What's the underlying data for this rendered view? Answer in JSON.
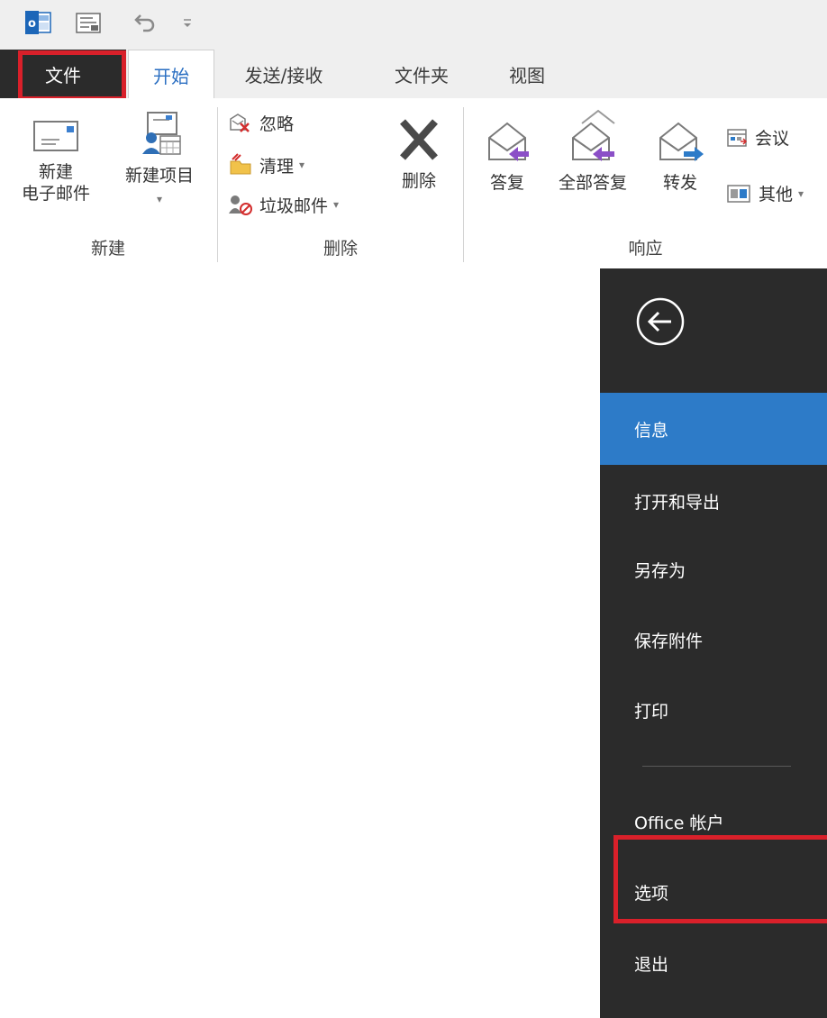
{
  "quick_access": {
    "icons": [
      "outlook-app-icon",
      "send-receive-all-icon",
      "undo-icon",
      "customize-qat-icon"
    ]
  },
  "tabs": [
    {
      "label": "文件"
    },
    {
      "label": "开始"
    },
    {
      "label": "发送/接收"
    },
    {
      "label": "文件夹"
    },
    {
      "label": "视图"
    }
  ],
  "ribbon": {
    "new_group": {
      "new_email_line1": "新建",
      "new_email_line2": "电子邮件",
      "new_items": "新建项目",
      "label": "新建"
    },
    "delete_group": {
      "ignore": "忽略",
      "clean_up": "清理",
      "junk": "垃圾邮件",
      "delete": "删除",
      "label": "删除"
    },
    "respond_group": {
      "reply": "答复",
      "reply_all": "全部答复",
      "forward": "转发",
      "meeting": "会议",
      "more": "其他",
      "label": "响应"
    },
    "caret": "▾"
  },
  "backstage": {
    "items": [
      {
        "label": "信息"
      },
      {
        "label": "打开和导出"
      },
      {
        "label": "另存为"
      },
      {
        "label": "保存附件"
      },
      {
        "label": "打印"
      },
      {
        "label": "Office 帐户"
      },
      {
        "label": "选项"
      },
      {
        "label": "退出"
      }
    ],
    "active_index": 0
  },
  "colors": {
    "backstage_bg": "#2b2b2b",
    "active_item": "#2d7bc8",
    "highlight_box": "#d9202a",
    "home_tab_text": "#2b6fc2"
  }
}
